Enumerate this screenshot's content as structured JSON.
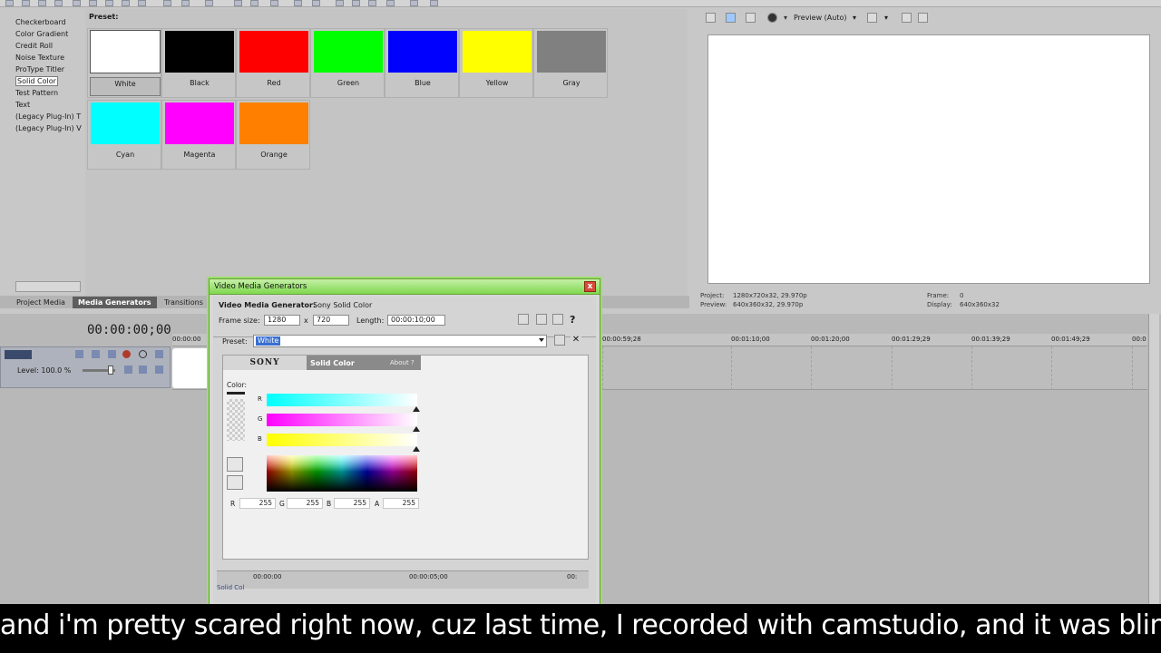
{
  "tree": {
    "items": [
      {
        "label": "Checkerboard",
        "selected": false
      },
      {
        "label": "Color Gradient",
        "selected": false
      },
      {
        "label": "Credit Roll",
        "selected": false
      },
      {
        "label": "Noise Texture",
        "selected": false
      },
      {
        "label": "ProType Titler",
        "selected": false
      },
      {
        "label": "Solid Color",
        "selected": true
      },
      {
        "label": "Test Pattern",
        "selected": false
      },
      {
        "label": "Text",
        "selected": false
      },
      {
        "label": "(Legacy Plug-In) T",
        "selected": false
      },
      {
        "label": "(Legacy Plug-In) V",
        "selected": false
      }
    ]
  },
  "presets": {
    "title": "Preset:",
    "items": [
      {
        "label": "White",
        "color": "#ffffff",
        "selected": true
      },
      {
        "label": "Black",
        "color": "#000000",
        "selected": false
      },
      {
        "label": "Red",
        "color": "#ff0000",
        "selected": false
      },
      {
        "label": "Green",
        "color": "#00ff00",
        "selected": false
      },
      {
        "label": "Blue",
        "color": "#0000ff",
        "selected": false
      },
      {
        "label": "Yellow",
        "color": "#ffff00",
        "selected": false
      },
      {
        "label": "Gray",
        "color": "#808080",
        "selected": false
      },
      {
        "label": "Cyan",
        "color": "#00ffff",
        "selected": false
      },
      {
        "label": "Magenta",
        "color": "#ff00ff",
        "selected": false
      },
      {
        "label": "Orange",
        "color": "#ff8000",
        "selected": false
      }
    ]
  },
  "tabs": {
    "project_media": "Project Media",
    "media_generators": "Media Generators",
    "transitions": "Transitions"
  },
  "preview": {
    "mode_label": "Preview (Auto)",
    "project_label": "Project:",
    "project_value": "1280x720x32, 29.970p",
    "preview_label": "Preview:",
    "preview_value": "640x360x32, 29.970p",
    "frame_label": "Frame:",
    "frame_value": "0",
    "display_label": "Display:",
    "display_value": "640x360x32"
  },
  "timeline": {
    "timecode": "00:00:00;00",
    "level_label": "Level: 100.0 %",
    "ruler": [
      "00:00:00",
      "00:00:59;28",
      "00:01:10;00",
      "00:01:20;00",
      "00:01:29;29",
      "00:01:39;29",
      "00:01:49;29",
      "00:0"
    ]
  },
  "dialog": {
    "title": "Video Media Generators",
    "close": "x",
    "generator_label": "Video Media Generator:",
    "generator_name": "Sony Solid Color",
    "frame_size_label": "Frame size:",
    "frame_w": "1280",
    "frame_x": "x",
    "frame_h": "720",
    "length_label": "Length:",
    "length_value": "00:00:10;00",
    "help": "?",
    "preset_label": "Preset:",
    "preset_value": "White",
    "sony": "SONY",
    "plugin_title": "Solid Color",
    "about": "About",
    "about_q": "?",
    "color_label": "Color:",
    "r_label": "R",
    "g_label": "G",
    "b_label": "B",
    "a_label": "A",
    "r_value": "255",
    "g_value": "255",
    "b_value": "255",
    "a_value": "255",
    "tl_start": "00:00:00",
    "tl_mid": "00:00:05;00",
    "tl_end": "00:",
    "tl_track": "Solid Col"
  },
  "caption": {
    "text": "and i'm pretty scared right now, cuz last time, I recorded with camstudio, and it was blinking"
  }
}
